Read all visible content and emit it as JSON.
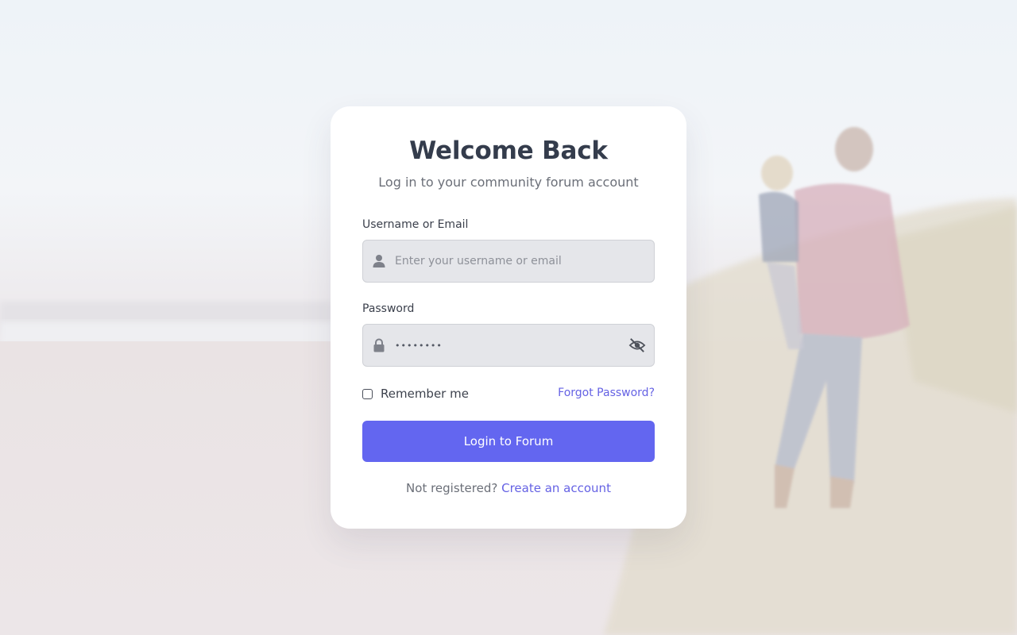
{
  "login": {
    "title": "Welcome Back",
    "subtitle": "Log in to your community forum account",
    "username_label": "Username or Email",
    "username_placeholder": "Enter your username or email",
    "username_icon": "user-icon",
    "password_label": "Password",
    "password_value": "••••••••",
    "password_icon": "lock-icon",
    "toggle_visibility_icon": "eye-off-icon",
    "remember_label": "Remember me",
    "remember_checked": false,
    "forgot_link": "Forgot Password?",
    "submit_label": "Login to Forum",
    "footer_text": "Not registered?",
    "footer_link": "Create an account"
  },
  "colors": {
    "accent": "#6366f0",
    "link": "#6562e4",
    "title": "#343c4c",
    "input_bg": "#e5e6ea"
  }
}
